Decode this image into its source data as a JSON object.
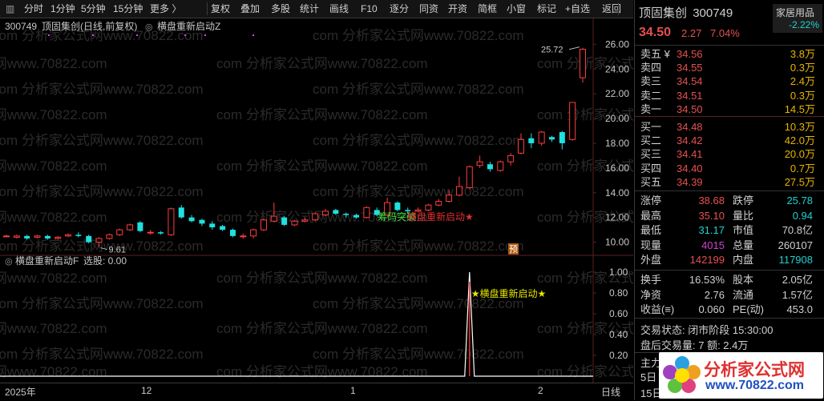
{
  "toolbar": {
    "items": [
      "分时",
      "1分钟",
      "5分钟",
      "15分钟",
      "更多 〉",
      "复权",
      "叠加",
      "多股",
      "统计",
      "画线",
      "F10",
      "逐分",
      "同资",
      "开资",
      "简框",
      "小窗",
      "标记",
      "+自选",
      "返回"
    ]
  },
  "main_chart": {
    "header_code": "300749",
    "header_name": "顶固集创",
    "header_period": "(日线,前复权)",
    "indicator_name": "横盘重新启动Z",
    "high_label": "25.72",
    "low_label": "9.61",
    "signal_label_1": "筹码突破",
    "signal_label_2": "横盘重新启动★",
    "yu_badge": "预",
    "price_ticks": [
      "26.00",
      "24.00",
      "22.00",
      "20.00",
      "18.00",
      "16.00",
      "14.00",
      "12.00",
      "10.00"
    ]
  },
  "sub_chart": {
    "title": "横盘重新启动F",
    "select_label": "选股: 0.00",
    "signal_label": "★横盘重新启动★",
    "ticks": [
      "1.00",
      "0.80",
      "0.60",
      "0.40",
      "0.20"
    ]
  },
  "x_axis": {
    "labels": [
      "2025年",
      "12",
      "1",
      "2"
    ],
    "right_label": "日线"
  },
  "watermark": "com 分析家公式网www.70822.com",
  "chart_data": {
    "type": "candlestick",
    "title": "300749 顶固集创 (日线,前复权)",
    "ylim": [
      9.0,
      26.8
    ],
    "high": 25.72,
    "low": 9.61,
    "candles": [
      {
        "o": 10.5,
        "c": 10.5,
        "h": 10.6,
        "l": 10.4
      },
      {
        "o": 10.4,
        "c": 10.5,
        "h": 10.6,
        "l": 10.3
      },
      {
        "o": 10.5,
        "c": 10.3,
        "h": 10.6,
        "l": 10.2
      },
      {
        "o": 10.4,
        "c": 10.5,
        "h": 10.6,
        "l": 10.3
      },
      {
        "o": 10.5,
        "c": 10.3,
        "h": 10.6,
        "l": 10.2
      },
      {
        "o": 10.3,
        "c": 10.4,
        "h": 10.5,
        "l": 10.2
      },
      {
        "o": 10.5,
        "c": 10.6,
        "h": 10.7,
        "l": 10.4
      },
      {
        "o": 10.6,
        "c": 10.5,
        "h": 10.8,
        "l": 10.4
      },
      {
        "o": 10.5,
        "c": 10.0,
        "h": 10.6,
        "l": 9.9
      },
      {
        "o": 10.0,
        "c": 10.3,
        "h": 10.4,
        "l": 9.61
      },
      {
        "o": 10.3,
        "c": 10.6,
        "h": 10.7,
        "l": 10.2
      },
      {
        "o": 10.6,
        "c": 11.0,
        "h": 11.1,
        "l": 10.5
      },
      {
        "o": 11.0,
        "c": 11.4,
        "h": 11.5,
        "l": 10.9
      },
      {
        "o": 11.6,
        "c": 10.9,
        "h": 11.7,
        "l": 10.8
      },
      {
        "o": 10.8,
        "c": 10.8,
        "h": 11.0,
        "l": 10.6
      },
      {
        "o": 10.8,
        "c": 10.7,
        "h": 10.9,
        "l": 10.6
      },
      {
        "o": 10.6,
        "c": 12.7,
        "h": 12.8,
        "l": 10.5
      },
      {
        "o": 12.8,
        "c": 12.0,
        "h": 13.0,
        "l": 11.9
      },
      {
        "o": 12.0,
        "c": 11.7,
        "h": 12.2,
        "l": 11.6
      },
      {
        "o": 11.8,
        "c": 11.5,
        "h": 11.9,
        "l": 11.3
      },
      {
        "o": 11.5,
        "c": 11.2,
        "h": 11.7,
        "l": 11.0
      },
      {
        "o": 11.3,
        "c": 11.0,
        "h": 11.4,
        "l": 10.9
      },
      {
        "o": 11.0,
        "c": 10.5,
        "h": 11.1,
        "l": 10.4
      },
      {
        "o": 10.5,
        "c": 10.5,
        "h": 10.7,
        "l": 10.3
      },
      {
        "o": 10.5,
        "c": 11.0,
        "h": 11.1,
        "l": 10.3
      },
      {
        "o": 11.0,
        "c": 11.8,
        "h": 11.9,
        "l": 10.9
      },
      {
        "o": 11.7,
        "c": 12.1,
        "h": 13.2,
        "l": 11.6
      },
      {
        "o": 12.0,
        "c": 11.4,
        "h": 12.1,
        "l": 11.3
      },
      {
        "o": 11.4,
        "c": 11.7,
        "h": 11.8,
        "l": 11.3
      },
      {
        "o": 11.7,
        "c": 11.8,
        "h": 12.0,
        "l": 11.6
      },
      {
        "o": 11.8,
        "c": 12.3,
        "h": 12.4,
        "l": 11.7
      },
      {
        "o": 12.2,
        "c": 12.5,
        "h": 12.7,
        "l": 12.1
      },
      {
        "o": 12.6,
        "c": 12.3,
        "h": 12.7,
        "l": 12.2
      },
      {
        "o": 12.3,
        "c": 12.2,
        "h": 12.4,
        "l": 12.0
      },
      {
        "o": 12.2,
        "c": 12.0,
        "h": 12.3,
        "l": 11.9
      },
      {
        "o": 12.0,
        "c": 12.8,
        "h": 12.9,
        "l": 11.9
      },
      {
        "o": 12.6,
        "c": 12.2,
        "h": 12.8,
        "l": 12.1
      },
      {
        "o": 12.2,
        "c": 13.2,
        "h": 13.6,
        "l": 12.1
      },
      {
        "o": 13.2,
        "c": 12.6,
        "h": 13.3,
        "l": 12.5
      },
      {
        "o": 12.6,
        "c": 12.5,
        "h": 12.8,
        "l": 12.3
      },
      {
        "o": 12.5,
        "c": 12.6,
        "h": 12.8,
        "l": 12.4
      },
      {
        "o": 12.6,
        "c": 13.0,
        "h": 13.1,
        "l": 12.5
      },
      {
        "o": 13.0,
        "c": 13.3,
        "h": 13.5,
        "l": 12.9
      },
      {
        "o": 13.3,
        "c": 13.8,
        "h": 14.2,
        "l": 13.2
      },
      {
        "o": 13.8,
        "c": 14.5,
        "h": 15.3,
        "l": 13.7
      },
      {
        "o": 14.4,
        "c": 16.1,
        "h": 16.2,
        "l": 14.3
      },
      {
        "o": 16.2,
        "c": 16.5,
        "h": 17.0,
        "l": 16.0
      },
      {
        "o": 16.3,
        "c": 15.9,
        "h": 16.5,
        "l": 15.7
      },
      {
        "o": 15.8,
        "c": 16.5,
        "h": 16.6,
        "l": 15.7
      },
      {
        "o": 16.5,
        "c": 17.0,
        "h": 17.2,
        "l": 16.2
      },
      {
        "o": 17.2,
        "c": 18.3,
        "h": 18.8,
        "l": 17.1
      },
      {
        "o": 18.4,
        "c": 18.0,
        "h": 18.8,
        "l": 17.6
      },
      {
        "o": 18.0,
        "c": 18.9,
        "h": 19.0,
        "l": 17.8
      },
      {
        "o": 18.5,
        "c": 18.3,
        "h": 18.6,
        "l": 18.1
      },
      {
        "o": 18.9,
        "c": 18.0,
        "h": 19.0,
        "l": 17.5
      },
      {
        "o": 18.3,
        "c": 21.3,
        "h": 21.3,
        "l": 18.2
      },
      {
        "o": 23.3,
        "c": 25.6,
        "h": 25.72,
        "l": 22.9
      }
    ],
    "signal_value_series": {
      "index": 45,
      "value": 1.0
    }
  },
  "quote": {
    "name": "顶固集创",
    "code": "300749",
    "sector": "家居用品",
    "sector_change": "-2.22%",
    "sector_color": "#00c8c8",
    "price": "34.50",
    "change": "2.27",
    "change_pct": "7.04%",
    "sell": [
      {
        "label": "卖五 ¥",
        "price": "34.56",
        "vol": "3.8万"
      },
      {
        "label": "卖四",
        "price": "34.55",
        "vol": "0.3万"
      },
      {
        "label": "卖三",
        "price": "34.54",
        "vol": "2.4万"
      },
      {
        "label": "卖二",
        "price": "34.51",
        "vol": "0.3万"
      },
      {
        "label": "卖一",
        "price": "34.50",
        "vol": "14.5万"
      }
    ],
    "buy": [
      {
        "label": "买一",
        "price": "34.48",
        "vol": "10.3万"
      },
      {
        "label": "买二",
        "price": "34.42",
        "vol": "42.0万"
      },
      {
        "label": "买三",
        "price": "34.41",
        "vol": "20.0万"
      },
      {
        "label": "买四",
        "price": "34.40",
        "vol": "0.7万"
      },
      {
        "label": "买五",
        "price": "34.39",
        "vol": "27.5万"
      }
    ],
    "stats1": [
      {
        "l1": "涨停",
        "v1": "38.68",
        "c1": "#e65050",
        "l2": "跌停",
        "v2": "25.78",
        "c2": "#20d0d0"
      },
      {
        "l1": "最高",
        "v1": "35.10",
        "c1": "#e65050",
        "l2": "量比",
        "v2": "0.94",
        "c2": "#20d0d0"
      },
      {
        "l1": "最低",
        "v1": "31.17",
        "c1": "#20d0d0",
        "l2": "市值",
        "v2": "70.8亿",
        "c2": "#d0d0d0"
      },
      {
        "l1": "现量",
        "v1": "4015",
        "c1": "#d040d0",
        "l2": "总量",
        "v2": "260107",
        "c2": "#d0d0d0"
      },
      {
        "l1": "外盘",
        "v1": "142199",
        "c1": "#e65050",
        "l2": "内盘",
        "v2": "117908",
        "c2": "#20d0d0"
      }
    ],
    "stats2": [
      {
        "l1": "换手",
        "v1": "16.53%",
        "l2": "股本",
        "v2": "2.05亿"
      },
      {
        "l1": "净资",
        "v1": "2.76",
        "l2": "流通",
        "v2": "1.57亿"
      },
      {
        "l1": "收益(≡)",
        "v1": "0.060",
        "l2": "PE(动)",
        "v2": "453.0"
      }
    ],
    "trade_status": "交易状态: 闭市阶段 15:30:00",
    "after_hours": "盘后交易量: 7  额: 2.4万",
    "main_label": "主力",
    "five_label": "5日",
    "fifteen_label": "15日",
    "logo_text": "分析家公式网",
    "logo_url": "www.70822.com"
  }
}
